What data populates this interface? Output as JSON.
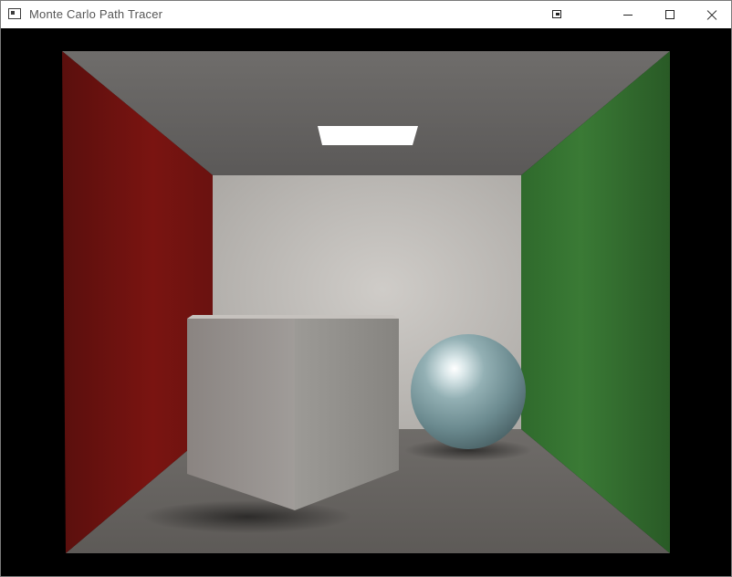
{
  "window": {
    "title": "Monte Carlo Path Tracer",
    "icon": "app-window-icon",
    "controls": [
      "snap-layout-icon",
      "minimize-icon",
      "maximize-icon",
      "close-icon"
    ]
  },
  "render": {
    "background": "#000000",
    "left_wall_color": "#7a1411",
    "right_wall_color": "#2f6a2c",
    "back_wall_color": "#c9c6c2",
    "sphere_color": "#a9c2c5"
  }
}
